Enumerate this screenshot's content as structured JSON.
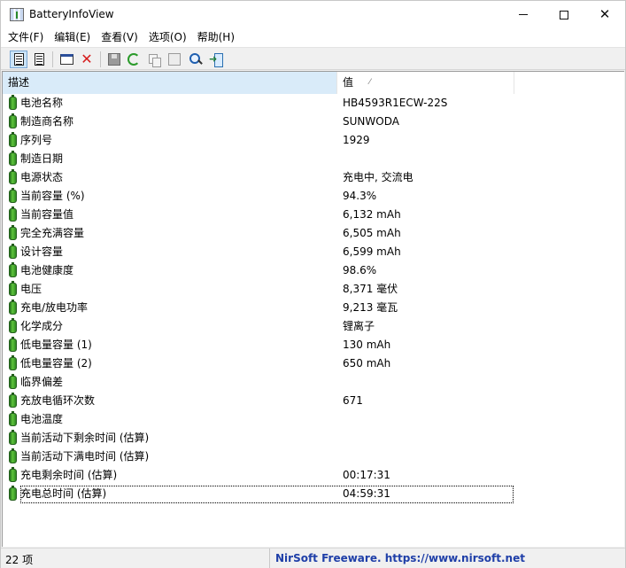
{
  "window": {
    "title": "BatteryInfoView",
    "minimize_glyph": "—",
    "close_glyph": "✕"
  },
  "menu": [
    {
      "label": "文件(F)"
    },
    {
      "label": "编辑(E)"
    },
    {
      "label": "查看(V)"
    },
    {
      "label": "选项(O)"
    },
    {
      "label": "帮助(H)"
    }
  ],
  "toolbar": {
    "buttons": [
      {
        "icon": "battery-info-mode-icon",
        "pressed": true
      },
      {
        "icon": "battery-log-mode-icon",
        "pressed": false
      },
      {
        "icon": "window-icon",
        "pressed": false
      },
      {
        "icon": "delete-icon",
        "pressed": false
      },
      {
        "icon": "save-icon",
        "pressed": false
      },
      {
        "icon": "refresh-icon",
        "pressed": false
      },
      {
        "icon": "copy-icon",
        "pressed": false
      },
      {
        "icon": "properties-icon",
        "pressed": false
      },
      {
        "icon": "find-icon",
        "pressed": false
      },
      {
        "icon": "exit-icon",
        "pressed": false
      }
    ]
  },
  "list": {
    "headers": {
      "description": "描述",
      "value": "值",
      "sort_indicator": "⁄"
    },
    "rows": [
      {
        "label": "电池名称",
        "value": "HB4593R1ECW-22S"
      },
      {
        "label": "制造商名称",
        "value": "SUNWODA"
      },
      {
        "label": "序列号",
        "value": "1929"
      },
      {
        "label": "制造日期",
        "value": ""
      },
      {
        "label": "电源状态",
        "value": "充电中, 交流电"
      },
      {
        "label": "当前容量 (%)",
        "value": "94.3%"
      },
      {
        "label": "当前容量值",
        "value": "6,132 mAh"
      },
      {
        "label": "完全充满容量",
        "value": "6,505 mAh"
      },
      {
        "label": "设计容量",
        "value": "6,599 mAh"
      },
      {
        "label": "电池健康度",
        "value": "98.6%"
      },
      {
        "label": "电压",
        "value": "8,371 毫伏"
      },
      {
        "label": "充电/放电功率",
        "value": "9,213 毫瓦"
      },
      {
        "label": "化学成分",
        "value": "锂离子"
      },
      {
        "label": "低电量容量 (1)",
        "value": "130 mAh"
      },
      {
        "label": "低电量容量 (2)",
        "value": "650 mAh"
      },
      {
        "label": "临界偏差",
        "value": ""
      },
      {
        "label": "充放电循环次数",
        "value": "671"
      },
      {
        "label": "电池温度",
        "value": ""
      },
      {
        "label": "当前活动下剩余时间 (估算)",
        "value": ""
      },
      {
        "label": "当前活动下满电时间 (估算)",
        "value": ""
      },
      {
        "label": "充电剩余时间 (估算)",
        "value": "00:17:31"
      },
      {
        "label": "充电总时间 (估算)",
        "value": "04:59:31"
      }
    ]
  },
  "status": {
    "count": "22 项",
    "link": "NirSoft Freeware. https://www.nirsoft.net",
    "link_color": "#1f3fa8"
  }
}
